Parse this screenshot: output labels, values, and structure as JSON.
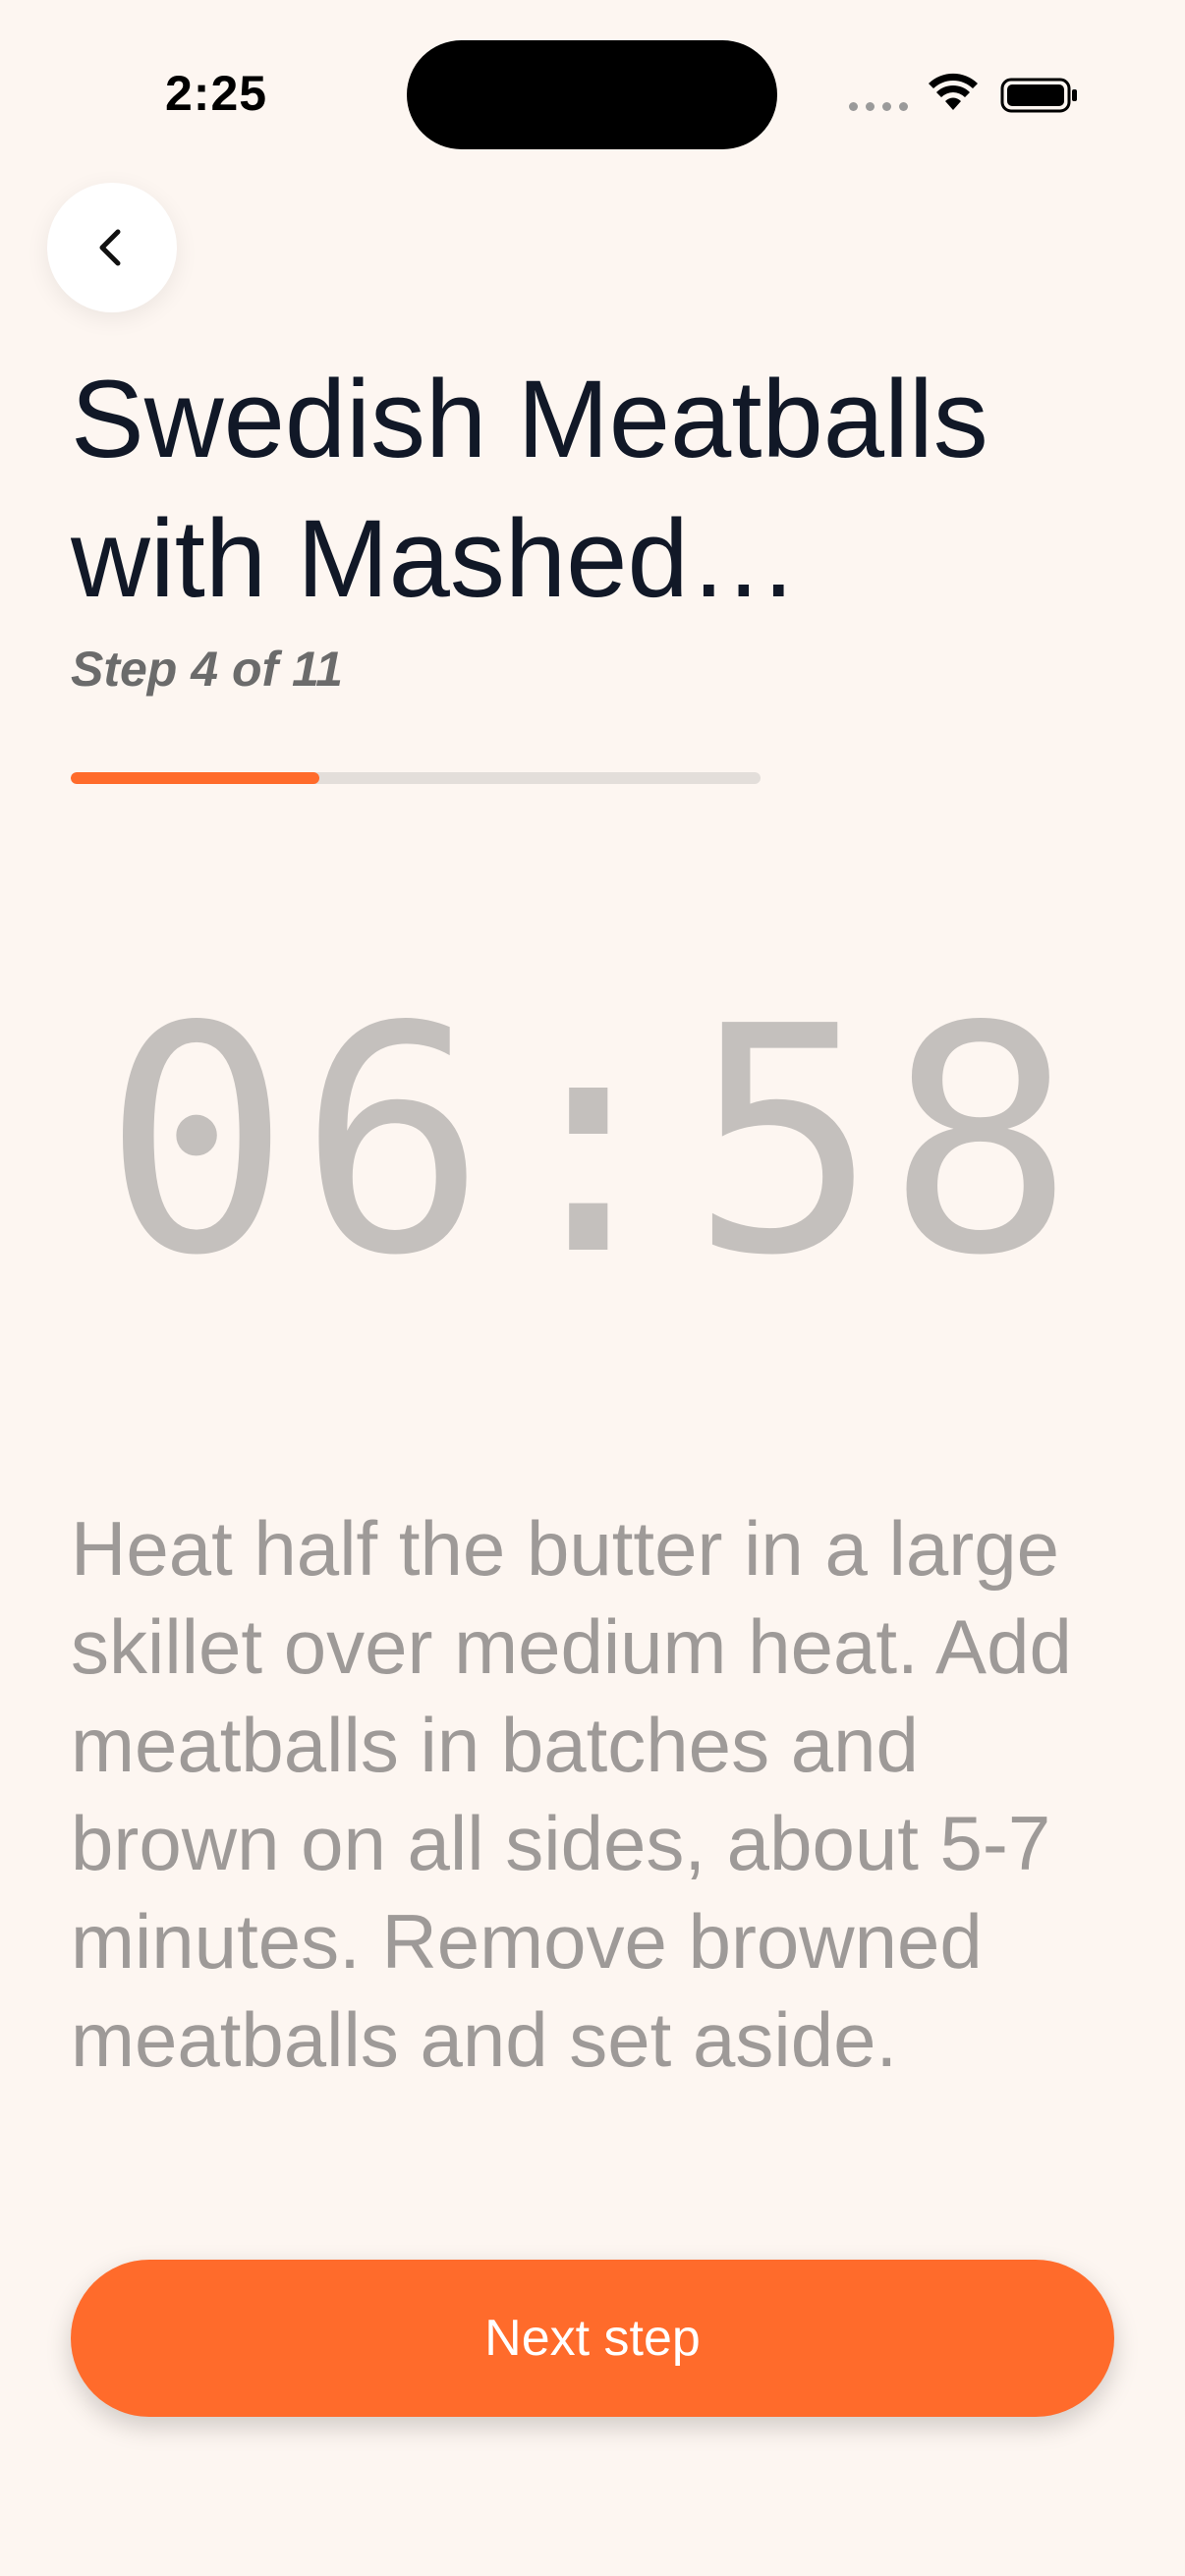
{
  "status_bar": {
    "time": "2:25"
  },
  "header": {
    "back_icon": "chevron-left-icon",
    "title": "Swedish Meatballs with Mashed Potatoes",
    "step_label": "Step 4 of 11"
  },
  "progress": {
    "current_step": 4,
    "total_steps": 11,
    "fraction": 0.36,
    "fill_color": "#FF6B2B",
    "track_color": "#E3DEDA"
  },
  "timer": {
    "display": "06:58"
  },
  "step": {
    "instructions": "Heat half the butter in a large skillet over medium heat. Add meatballs in batches and brown on all sides, about 5-7 minutes. Remove browned meatballs and set aside."
  },
  "actions": {
    "next_label": "Next step"
  },
  "colors": {
    "background": "#FDF6F1",
    "accent": "#FF6B2B",
    "title": "#111827",
    "muted_text": "#9E9A98"
  }
}
